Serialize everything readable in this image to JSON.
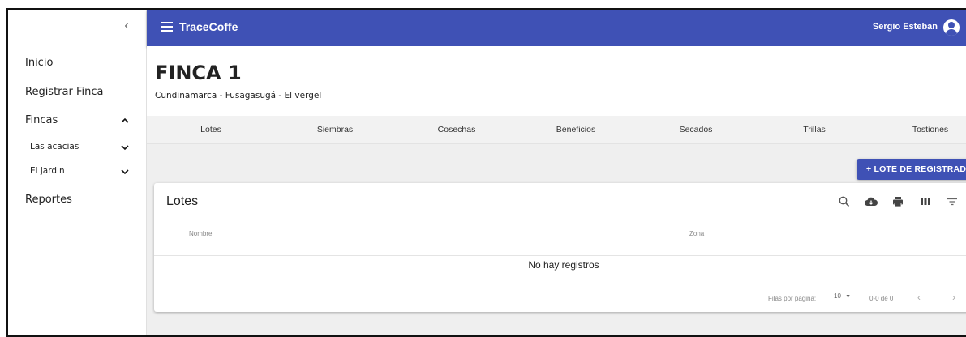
{
  "sidebar": {
    "collapse_icon": "chevron-left-icon",
    "items": [
      {
        "label": "Inicio"
      },
      {
        "label": "Registrar Finca"
      },
      {
        "label": "Fincas",
        "chevron": "^"
      },
      {
        "label": "Las acacias",
        "chevron": "⌄"
      },
      {
        "label": "El jardin",
        "chevron": "⌄"
      },
      {
        "label": "Reportes"
      }
    ]
  },
  "appbar": {
    "title": "TraceCoffe",
    "user": "Sergio Esteban",
    "color": "#3f51b5"
  },
  "page": {
    "title": "FINCA 1",
    "subtitle": "Cundinamarca - Fusagasugá - El vergel"
  },
  "tabs": [
    "Lotes",
    "Siembras",
    "Cosechas",
    "Beneficios",
    "Secados",
    "Trillas",
    "Tostiones"
  ],
  "add_button": {
    "label": "+ LOTE DE REGISTRADO"
  },
  "table": {
    "title": "Lotes",
    "toolbar_icons": [
      "search-icon",
      "cloud-download-icon",
      "print-icon",
      "view-column-icon",
      "filter-icon"
    ],
    "columns": [
      "Nombre",
      "Zona"
    ],
    "empty_message": "No hay registros",
    "rows_per_page_label": "Filas por pagina:",
    "rows_per_page_value": "10",
    "range_label": "0-0 de 0",
    "prev_icon": "chevron-left-icon",
    "next_icon": "chevron-right-icon"
  }
}
